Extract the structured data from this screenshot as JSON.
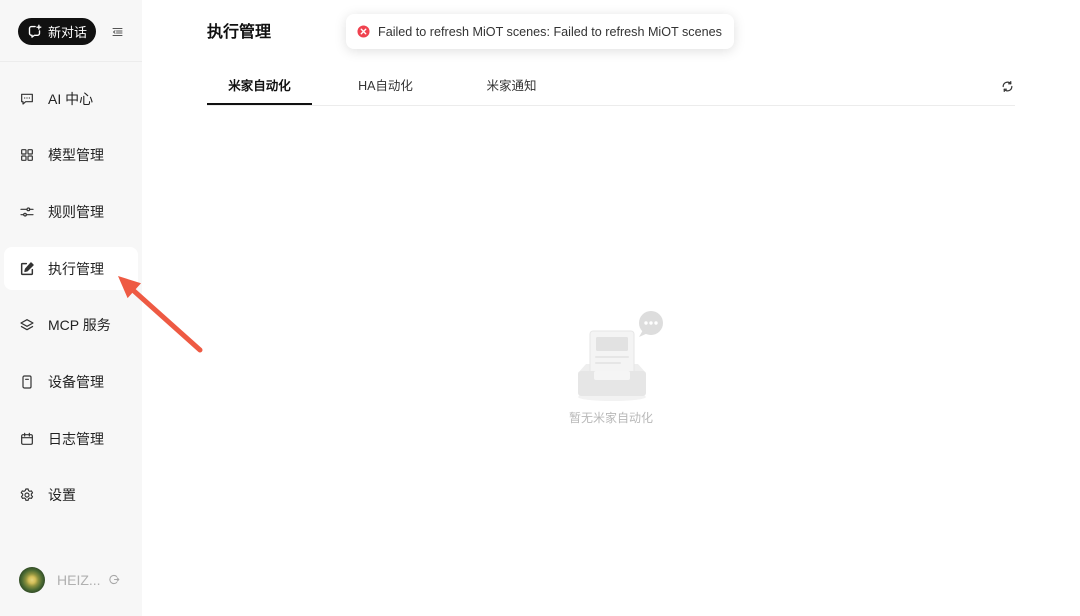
{
  "colors": {
    "error": "#f0424f",
    "annotation_arrow": "#ee5a43"
  },
  "sidebar": {
    "new_chat": {
      "label": "新对话",
      "icon": "chat-plus-icon"
    },
    "collapse_icon": "collapse-sidebar-icon",
    "items": [
      {
        "label": "AI 中心",
        "icon": "message-dots-icon",
        "active": false
      },
      {
        "label": "模型管理",
        "icon": "grid-icon",
        "active": false
      },
      {
        "label": "规则管理",
        "icon": "sliders-icon",
        "active": false
      },
      {
        "label": "执行管理",
        "icon": "edit-square-icon",
        "active": true
      },
      {
        "label": "MCP 服务",
        "icon": "layers-icon",
        "active": false
      },
      {
        "label": "设备管理",
        "icon": "device-icon",
        "active": false
      },
      {
        "label": "日志管理",
        "icon": "calendar-icon",
        "active": false
      },
      {
        "label": "设置",
        "icon": "gear-icon",
        "active": false
      }
    ],
    "user": {
      "name": "HEIZ...",
      "logout_icon": "logout-icon"
    }
  },
  "main": {
    "title": "执行管理",
    "tabs": [
      {
        "label": "米家自动化",
        "active": true
      },
      {
        "label": "HA自动化",
        "active": false
      },
      {
        "label": "米家通知",
        "active": false
      }
    ],
    "refresh_icon": "refresh-icon",
    "empty_state": {
      "text": "暂无米家自动化",
      "icon": "empty-inbox-icon"
    }
  },
  "toast": {
    "icon": "error-circle-icon",
    "message": "Failed to refresh MiOT scenes: Failed to refresh MiOT scenes"
  }
}
